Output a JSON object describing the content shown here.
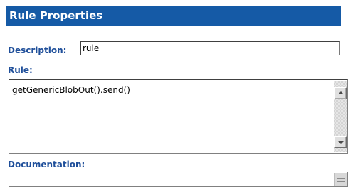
{
  "header": {
    "title": "Rule Properties"
  },
  "description": {
    "label": "Description:",
    "value": "rule"
  },
  "rule": {
    "label": "Rule:",
    "value": "getGenericBlobOut().send()"
  },
  "documentation": {
    "label": "Documentation:",
    "value": ""
  },
  "icons": {
    "scroll_up": "scroll-up-arrow-icon",
    "scroll_down": "scroll-down-arrow-icon",
    "resize_grip": "resize-grip-icon"
  },
  "colors": {
    "header_background": "#155aa6",
    "header_text": "#ffffff",
    "label_text": "#1f4f9a"
  }
}
